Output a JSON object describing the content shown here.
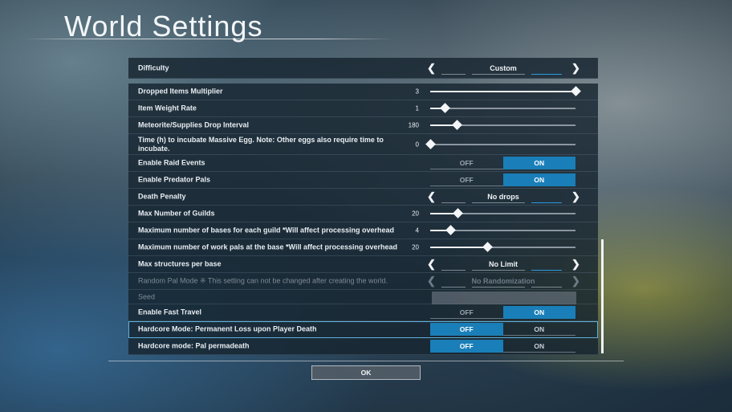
{
  "title": "World Settings",
  "ok_label": "OK",
  "colors": {
    "accent": "#1a7fb8",
    "panel": "#16242f"
  },
  "settings": [
    {
      "label": "Difficulty",
      "type": "selector",
      "value": "Custom"
    },
    {
      "label": "Dropped Items Multiplier",
      "type": "slider",
      "value": "3",
      "level": 1.0
    },
    {
      "label": "Item Weight Rate",
      "type": "slider",
      "value": "1",
      "level": 0.1
    },
    {
      "label": "Meteorite/Supplies Drop Interval",
      "type": "slider",
      "value": "180",
      "level": 0.18
    },
    {
      "label": "Time (h) to incubate Massive Egg. Note: Other eggs also require time to incubate.",
      "type": "slider",
      "value": "0",
      "level": 0.0
    },
    {
      "label": "Enable Raid Events",
      "type": "toggle",
      "off": "OFF",
      "on": "ON",
      "selected": "on"
    },
    {
      "label": "Enable Predator Pals",
      "type": "toggle",
      "off": "OFF",
      "on": "ON",
      "selected": "on"
    },
    {
      "label": "Death Penalty",
      "type": "selector",
      "value": "No drops"
    },
    {
      "label": "Max Number of Guilds",
      "type": "slider",
      "value": "20",
      "level": 0.19
    },
    {
      "label": "Maximum number of bases for each guild *Will affect processing overhead",
      "type": "slider",
      "value": "4",
      "level": 0.14
    },
    {
      "label": "Maximum number of work pals at the base *Will affect processing overhead",
      "type": "slider",
      "value": "20",
      "level": 0.39
    },
    {
      "label": "Max structures per base",
      "type": "selector",
      "value": "No Limit"
    },
    {
      "label": "Random Pal Mode ※ This setting can not be changed after creating the world.",
      "type": "selector",
      "value": "No Randomization",
      "disabled": true
    },
    {
      "label": "Seed",
      "type": "seed",
      "disabled": true
    },
    {
      "label": "Enable Fast Travel",
      "type": "toggle",
      "off": "OFF",
      "on": "ON",
      "selected": "on"
    },
    {
      "label": "Hardcore Mode: Permanent Loss upon Player Death",
      "type": "toggle",
      "off": "OFF",
      "on": "ON",
      "selected": "off",
      "focused": true
    },
    {
      "label": "Hardcore mode: Pal permadeath",
      "type": "toggle",
      "off": "OFF",
      "on": "ON",
      "selected": "off"
    }
  ]
}
